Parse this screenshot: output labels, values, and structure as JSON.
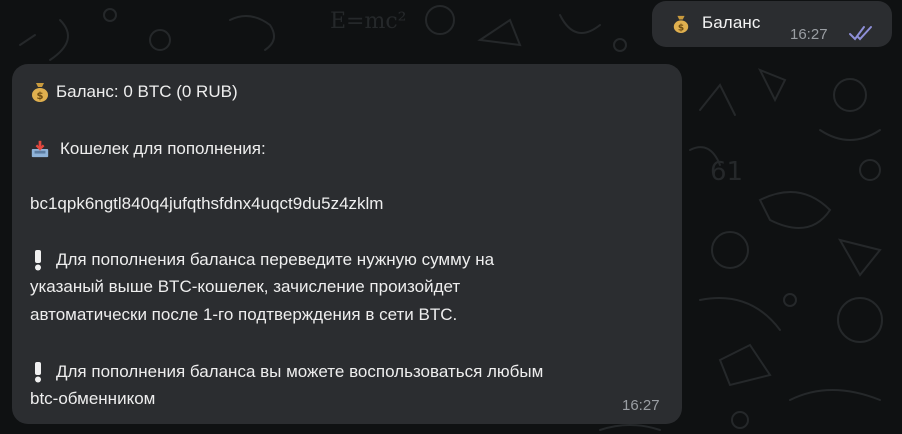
{
  "chat": {
    "outgoing": {
      "text": "Баланс",
      "time": "16:27",
      "emoji_icon": "money-bag-icon",
      "status_icon": "double-check-icon"
    },
    "incoming": {
      "balance_line": "Баланс: 0 BTC (0 RUB)",
      "wallet_heading": "Кошелек для пополнения:",
      "wallet_address": "bc1qpk6ngtl840q4jufqthsfdnx4uqct9du5z4zklm",
      "note1_line1": "Для пополнения баланса переведите нужную сумму на",
      "note1_line2": "указаный выше BTC-кошелек, зачисление произойдет",
      "note1_line3": "автоматически после 1-го подтверждения в сети BTC.",
      "note2_line1": "Для пополнения баланса вы можете воспользоваться любым",
      "note2_line2": "btc-обменником",
      "time": "16:27",
      "icons": [
        "money-bag-icon",
        "inbox-tray-icon",
        "exclamation-icon",
        "exclamation-icon"
      ]
    }
  },
  "colors": {
    "background": "#0f1112",
    "bubble": "#2b2d30",
    "text": "#eeeeee",
    "time": "#9a9ea3",
    "check": "#8e8fd8"
  }
}
